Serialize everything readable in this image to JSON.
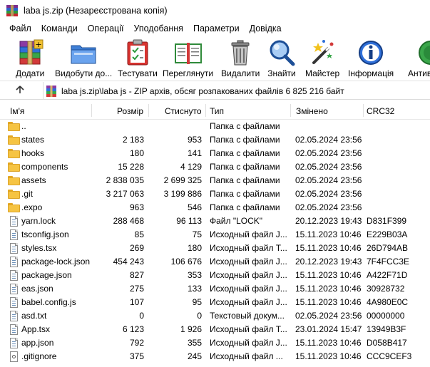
{
  "window": {
    "title": "laba js.zip (Незареєстрована копія)"
  },
  "menu": [
    "Файл",
    "Команди",
    "Операції",
    "Уподобання",
    "Параметри",
    "Довідка"
  ],
  "toolbar": {
    "buttons": [
      {
        "label": "Додати",
        "icon": "archive-add-icon"
      },
      {
        "label": "Видобути до...",
        "icon": "folder-extract-icon"
      },
      {
        "label": "Тестувати",
        "icon": "test-clipboard-icon"
      },
      {
        "label": "Переглянути",
        "icon": "book-view-icon"
      },
      {
        "label": "Видалити",
        "icon": "trash-icon"
      },
      {
        "label": "Знайти",
        "icon": "magnifier-icon"
      },
      {
        "label": "Майстер",
        "icon": "wand-icon"
      },
      {
        "label": "Інформація",
        "icon": "info-icon"
      },
      {
        "label": "Антив",
        "icon": "antivirus-icon"
      }
    ]
  },
  "address": {
    "text": "laba js.zip\\laba js - ZIP архів, обсяг розпакованих файлів 6 825 216 байт"
  },
  "columns": {
    "name": "Ім'я",
    "size": "Розмір",
    "packed": "Стиснуто",
    "type": "Тип",
    "modified": "Змінено",
    "crc": "CRC32"
  },
  "files": [
    {
      "name": "..",
      "size": "",
      "packed": "",
      "type": "Папка с файлами",
      "modified": "",
      "crc": "",
      "kind": "folder"
    },
    {
      "name": "states",
      "size": "2 183",
      "packed": "953",
      "type": "Папка с файлами",
      "modified": "02.05.2024 23:56",
      "crc": "",
      "kind": "folder"
    },
    {
      "name": "hooks",
      "size": "180",
      "packed": "141",
      "type": "Папка с файлами",
      "modified": "02.05.2024 23:56",
      "crc": "",
      "kind": "folder"
    },
    {
      "name": "components",
      "size": "15 228",
      "packed": "4 129",
      "type": "Папка с файлами",
      "modified": "02.05.2024 23:56",
      "crc": "",
      "kind": "folder"
    },
    {
      "name": "assets",
      "size": "2 838 035",
      "packed": "2 699 325",
      "type": "Папка с файлами",
      "modified": "02.05.2024 23:56",
      "crc": "",
      "kind": "folder"
    },
    {
      "name": ".git",
      "size": "3 217 063",
      "packed": "3 199 886",
      "type": "Папка с файлами",
      "modified": "02.05.2024 23:56",
      "crc": "",
      "kind": "folder"
    },
    {
      "name": ".expo",
      "size": "963",
      "packed": "546",
      "type": "Папка с файлами",
      "modified": "02.05.2024 23:56",
      "crc": "",
      "kind": "folder"
    },
    {
      "name": "yarn.lock",
      "size": "288 468",
      "packed": "96 113",
      "type": "Файл \"LOCK\"",
      "modified": "20.12.2023 19:43",
      "crc": "D831F399",
      "kind": "doc"
    },
    {
      "name": "tsconfig.json",
      "size": "85",
      "packed": "75",
      "type": "Исходный файл J...",
      "modified": "15.11.2023 10:46",
      "crc": "E229B03A",
      "kind": "doc"
    },
    {
      "name": "styles.tsx",
      "size": "269",
      "packed": "180",
      "type": "Исходный файл T...",
      "modified": "15.11.2023 10:46",
      "crc": "26D794AB",
      "kind": "doc"
    },
    {
      "name": "package-lock.json",
      "size": "454 243",
      "packed": "106 676",
      "type": "Исходный файл J...",
      "modified": "20.12.2023 19:43",
      "crc": "7F4FCC3E",
      "kind": "doc"
    },
    {
      "name": "package.json",
      "size": "827",
      "packed": "353",
      "type": "Исходный файл J...",
      "modified": "15.11.2023 10:46",
      "crc": "A422F71D",
      "kind": "doc"
    },
    {
      "name": "eas.json",
      "size": "275",
      "packed": "133",
      "type": "Исходный файл J...",
      "modified": "15.11.2023 10:46",
      "crc": "30928732",
      "kind": "doc"
    },
    {
      "name": "babel.config.js",
      "size": "107",
      "packed": "95",
      "type": "Исходный файл J...",
      "modified": "15.11.2023 10:46",
      "crc": "4A980E0C",
      "kind": "doc"
    },
    {
      "name": "asd.txt",
      "size": "0",
      "packed": "0",
      "type": "Текстовый докум...",
      "modified": "02.05.2024 23:56",
      "crc": "00000000",
      "kind": "doc"
    },
    {
      "name": "App.tsx",
      "size": "6 123",
      "packed": "1 926",
      "type": "Исходный файл T...",
      "modified": "23.01.2024 15:47",
      "crc": "13949B3F",
      "kind": "doc"
    },
    {
      "name": "app.json",
      "size": "792",
      "packed": "355",
      "type": "Исходный файл J...",
      "modified": "15.11.2023 10:46",
      "crc": "D058B417",
      "kind": "doc"
    },
    {
      "name": ".gitignore",
      "size": "375",
      "packed": "245",
      "type": "Исходный файл ...",
      "modified": "15.11.2023 10:46",
      "crc": "CCC9CEF3",
      "kind": "gear"
    }
  ]
}
